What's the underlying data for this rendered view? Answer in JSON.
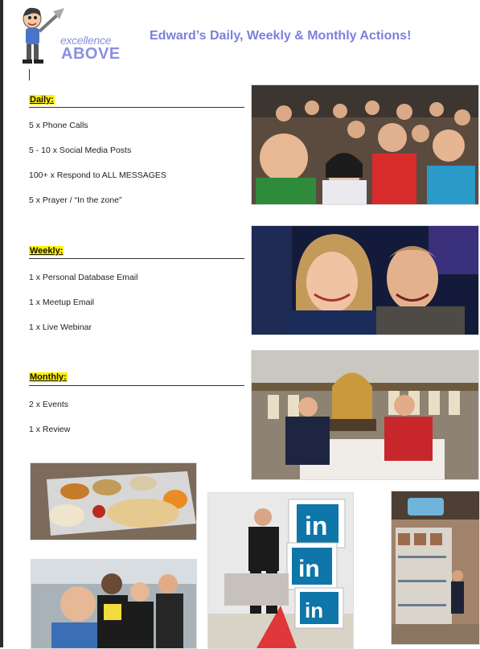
{
  "header": {
    "logo_text_1": "excellence",
    "logo_text_2": "ABOVE",
    "title": "Edward’s Daily, Weekly & Monthly Actions!"
  },
  "daily": {
    "heading": "Daily:",
    "items": [
      "5 x Phone Calls",
      "5 - 10 x Social Media Posts",
      "100+ x Respond to ALL MESSAGES",
      "5 x Prayer / “In the zone”"
    ]
  },
  "weekly": {
    "heading": "Weekly:",
    "items": [
      "1 x Personal Database Email",
      "1 x Meetup Email",
      "1 x Live Webinar"
    ]
  },
  "monthly": {
    "heading": "Monthly:",
    "items": [
      "2 x Events",
      "1 x Review"
    ]
  },
  "photos": {
    "linkedin_logo": "in"
  },
  "colors": {
    "title": "#7b80de",
    "highlight": "#fff200",
    "linkedin": "#0e76a8"
  }
}
